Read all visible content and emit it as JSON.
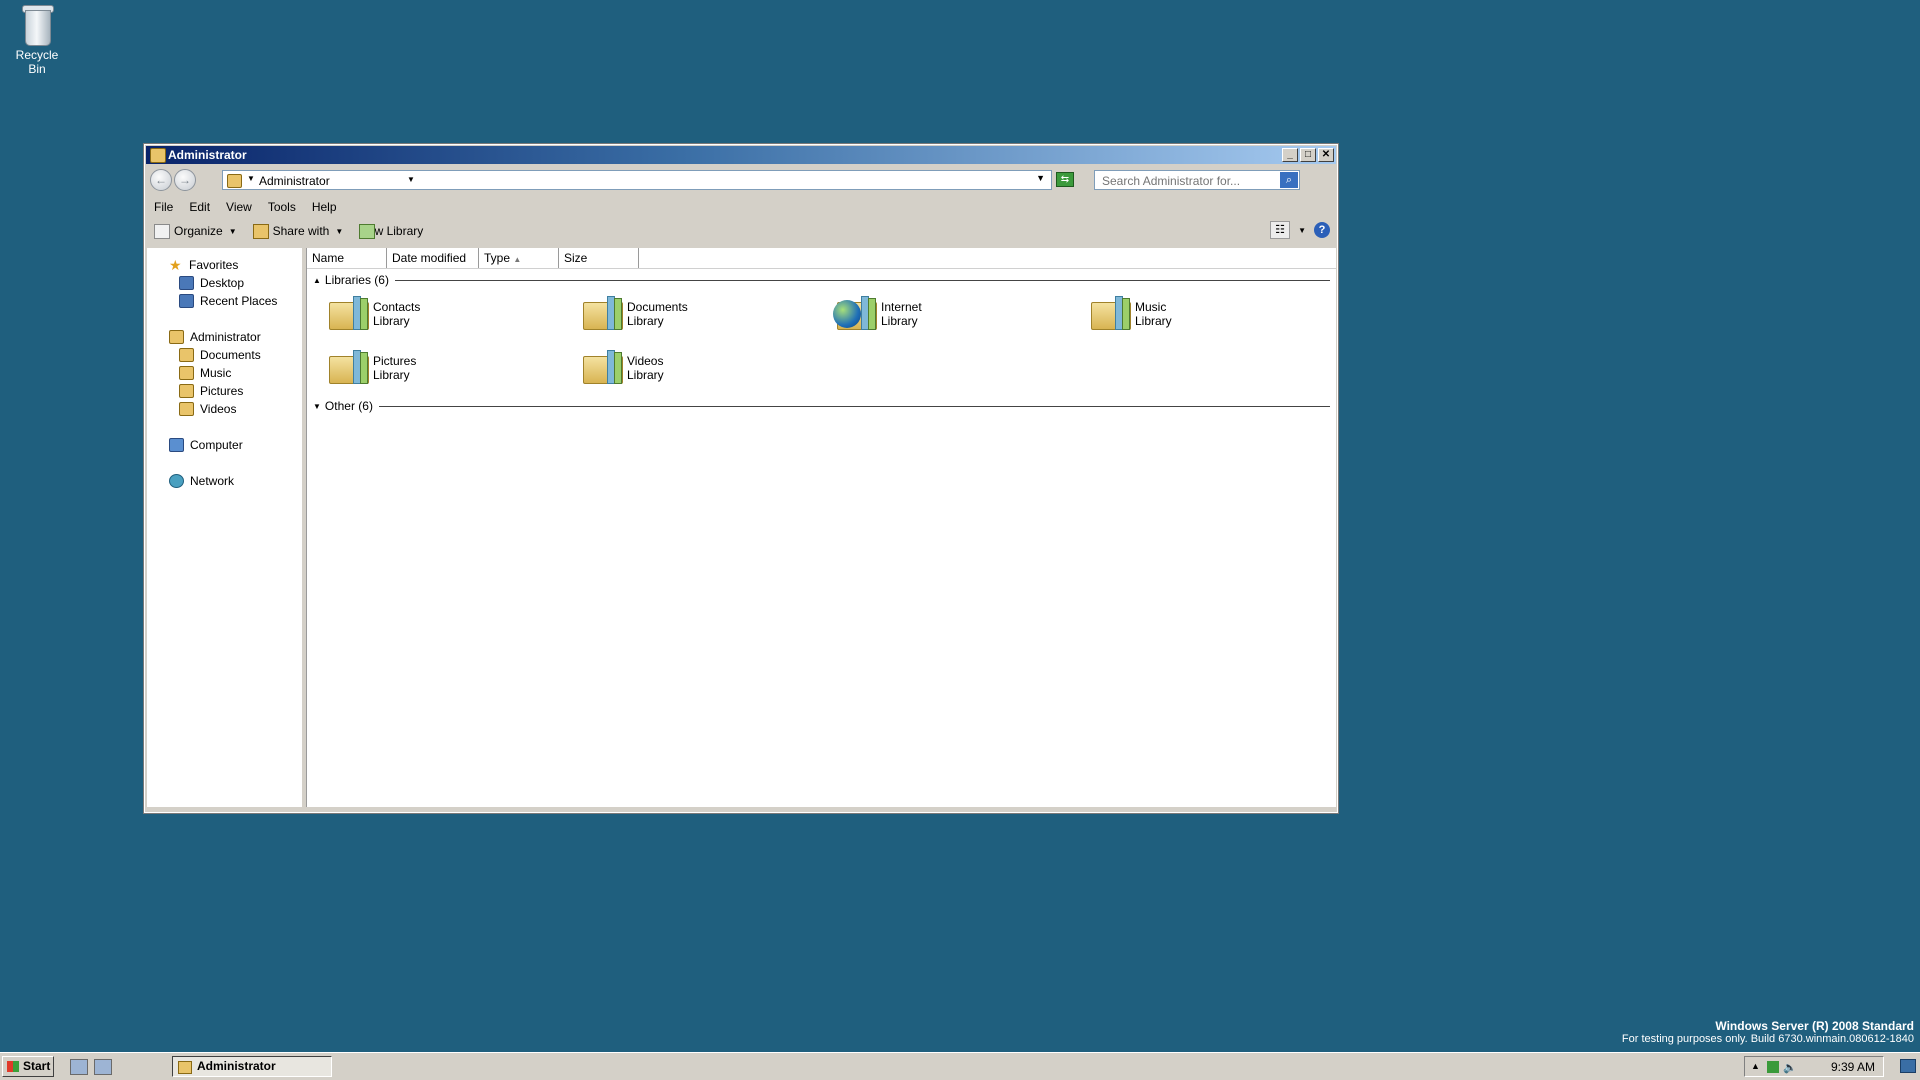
{
  "desktop": {
    "recycle_bin_label": "Recycle Bin",
    "watermark_line1": "Windows Server (R) 2008 Standard",
    "watermark_line2": "For testing purposes only. Build 6730.winmain.080612-1840"
  },
  "window": {
    "title": "Administrator",
    "address": "Administrator",
    "search_placeholder": "Search Administrator for...",
    "menu": [
      "File",
      "Edit",
      "View",
      "Tools",
      "Help"
    ],
    "toolbar": {
      "organize": "Organize",
      "share_with": "Share with",
      "new_library": "New Library"
    },
    "nav": {
      "favorites": "Favorites",
      "desktop": "Desktop",
      "recent_places": "Recent Places",
      "administrator": "Administrator",
      "documents": "Documents",
      "music": "Music",
      "pictures": "Pictures",
      "videos": "Videos",
      "computer": "Computer",
      "network": "Network"
    },
    "columns": [
      "Name",
      "Date modified",
      "Type",
      "Size"
    ],
    "groups": {
      "libraries": "Libraries (6)",
      "other": "Other (6)"
    },
    "libraries": [
      {
        "name": "Contacts",
        "sub": "Library"
      },
      {
        "name": "Documents",
        "sub": "Library"
      },
      {
        "name": "Internet",
        "sub": "Library"
      },
      {
        "name": "Music",
        "sub": "Library"
      },
      {
        "name": "Pictures",
        "sub": "Library"
      },
      {
        "name": "Videos",
        "sub": "Library"
      }
    ]
  },
  "taskbar": {
    "start_label": "Start",
    "task_label": "Administrator",
    "clock": "9:39 AM"
  },
  "colors": {
    "desktop_bg": "#1f5f7e",
    "title_active": "#0a246a",
    "chrome": "#d4d0c8"
  }
}
